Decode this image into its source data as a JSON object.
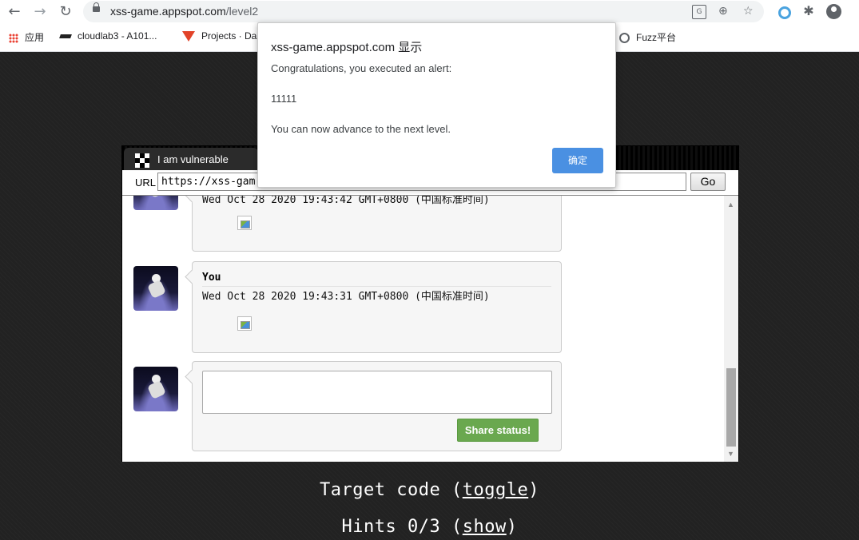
{
  "browser": {
    "url_host": "xss-game.appspot.com",
    "url_path": "/level2",
    "bookmarks": [
      {
        "label": "应用",
        "icon": "apps-icon"
      },
      {
        "label": "cloudlab3 - A101...",
        "icon": "graduation-cap-icon"
      },
      {
        "label": "Projects · Da",
        "icon": "gitlab-icon"
      },
      {
        "label": "Fuzz平台",
        "icon": "globe-icon"
      }
    ]
  },
  "frame": {
    "tab_title": "I am vulnerable",
    "url_label": "URL",
    "url_value": "https://xss-gam",
    "go_label": "Go"
  },
  "posts": [
    {
      "user": "",
      "date": "Wed Oct 28 2020 19:43:42 GMT+0800 (中国标准时间)"
    },
    {
      "user": "You",
      "date": "Wed Oct 28 2020 19:43:31 GMT+0800 (中国标准时间)"
    }
  ],
  "composer": {
    "value": "",
    "share_label": "Share status!"
  },
  "below": {
    "target_code_text": "Target code (",
    "target_code_link": "toggle",
    "target_code_end": ")",
    "hints_text": "Hints 0/3 (",
    "hints_link": "show",
    "hints_end": ")"
  },
  "dialog": {
    "title": "xss-game.appspot.com 显示",
    "message": "Congratulations, you executed an alert:",
    "value": "11111",
    "advance": "You can now advance to the next level.",
    "ok_label": "确定"
  },
  "colors": {
    "share_button": "#6aa84f",
    "ok_button": "#4a90e2",
    "page_bg": "#222222"
  }
}
